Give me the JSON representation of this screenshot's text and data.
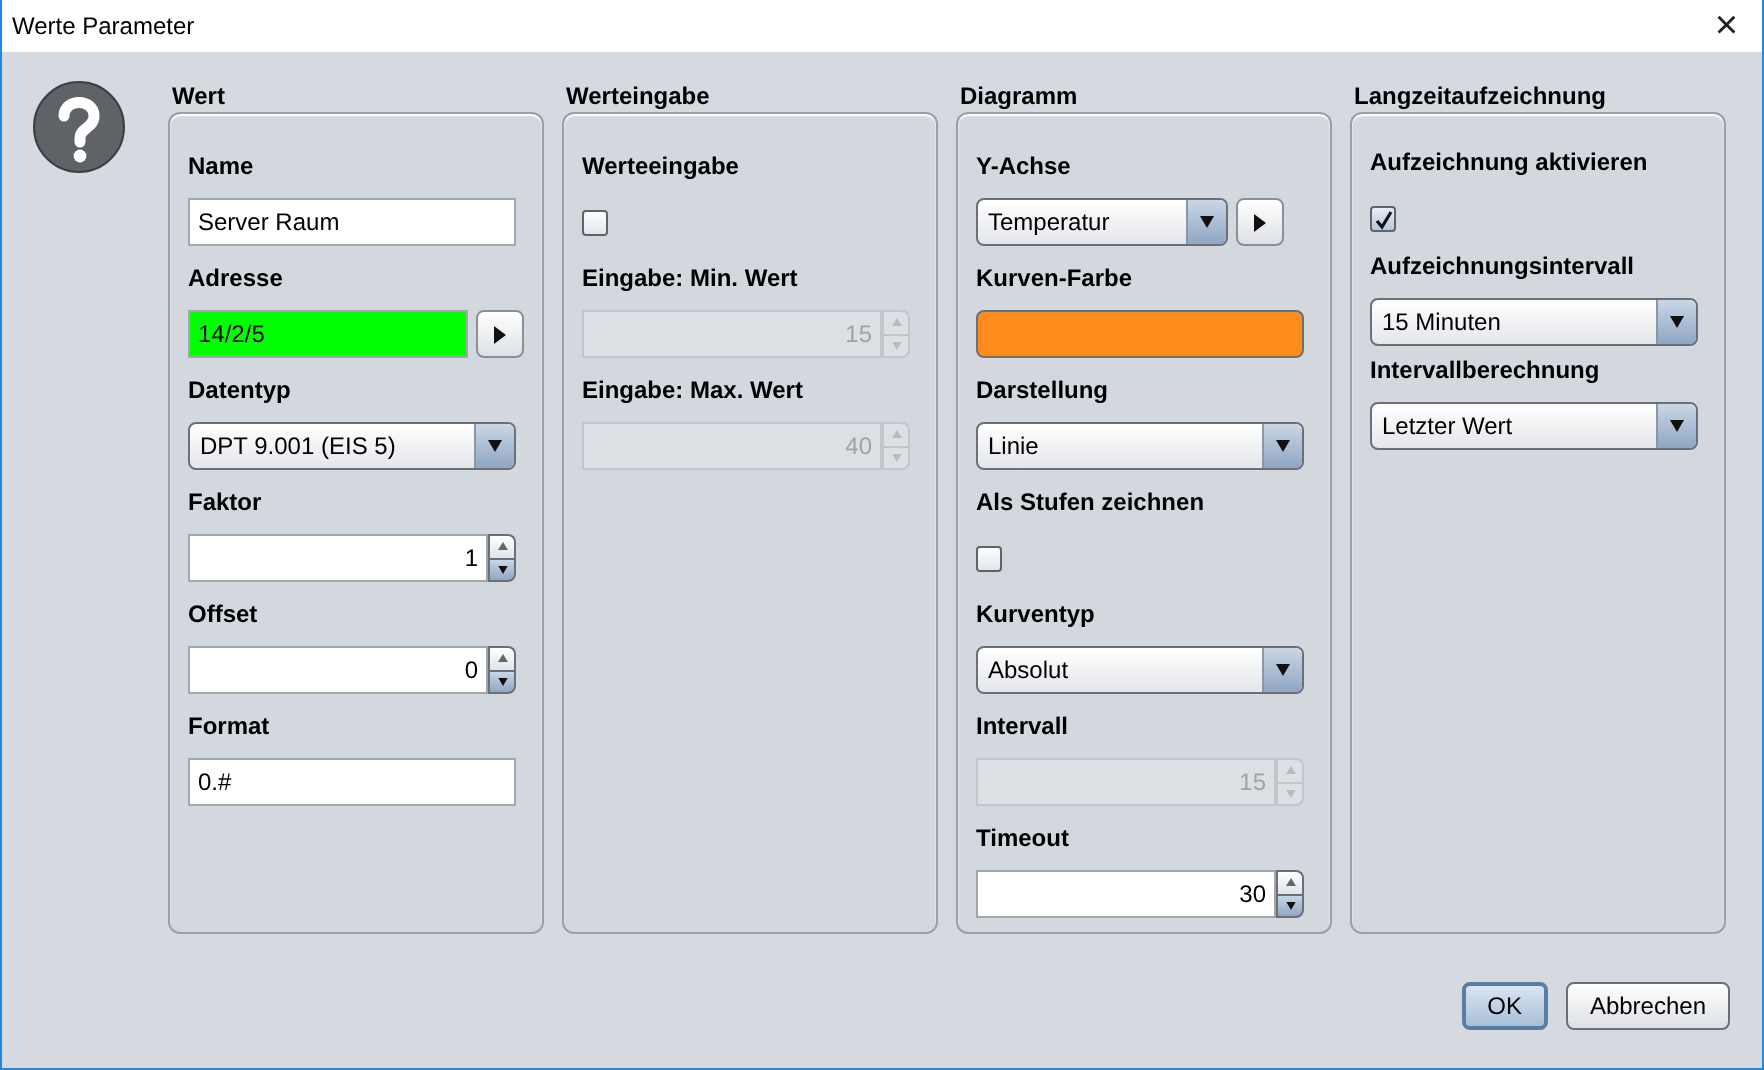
{
  "window": {
    "title": "Werte Parameter",
    "close": "×"
  },
  "panels": [
    {
      "title": "Wert",
      "fields": [
        {
          "kind": "text",
          "label": "Name",
          "value": "Server Raum"
        },
        {
          "kind": "text-button",
          "label": "Adresse",
          "value": "14/2/5",
          "color": "#00ff00"
        },
        {
          "kind": "select",
          "label": "Datentyp",
          "value": "DPT 9.001 (EIS 5)"
        },
        {
          "kind": "spinner",
          "label": "Faktor",
          "value": "1",
          "disabled": false
        },
        {
          "kind": "spinner",
          "label": "Offset",
          "value": "0",
          "disabled": false
        },
        {
          "kind": "text",
          "label": "Format",
          "value": "0.#"
        }
      ]
    },
    {
      "title": "Werteingabe",
      "fields": [
        {
          "kind": "checkbox",
          "label": "Werteeingabe",
          "checked": false
        },
        {
          "kind": "spinner",
          "label": "Eingabe: Min. Wert",
          "value": "15",
          "disabled": true
        },
        {
          "kind": "spinner",
          "label": "Eingabe: Max. Wert",
          "value": "40",
          "disabled": true
        }
      ]
    },
    {
      "title": "Diagramm",
      "fields": [
        {
          "kind": "select-button",
          "label": "Y-Achse",
          "value": "Temperatur"
        },
        {
          "kind": "color",
          "label": "Kurven-Farbe",
          "color": "#ff8c1a"
        },
        {
          "kind": "select",
          "label": "Darstellung",
          "value": "Linie"
        },
        {
          "kind": "checkbox",
          "label": "Als Stufen zeichnen",
          "checked": false
        },
        {
          "kind": "select",
          "label": "Kurventyp",
          "value": "Absolut"
        },
        {
          "kind": "spinner",
          "label": "Intervall",
          "value": "15",
          "disabled": true
        },
        {
          "kind": "spinner",
          "label": "Timeout",
          "value": "30",
          "disabled": false
        }
      ]
    },
    {
      "title": "Langzeitaufzeichnung",
      "fields": [
        {
          "kind": "checkbox",
          "label": "Aufzeichnung aktivieren",
          "checked": true
        },
        {
          "kind": "select",
          "label": "Aufzeichnungsintervall",
          "value": "15 Minuten"
        },
        {
          "kind": "select",
          "label": "Intervallberechnung",
          "value": "Letzter Wert"
        }
      ]
    }
  ],
  "buttons": [
    {
      "label": "OK",
      "default": true
    },
    {
      "label": "Abbrechen",
      "default": false
    }
  ]
}
